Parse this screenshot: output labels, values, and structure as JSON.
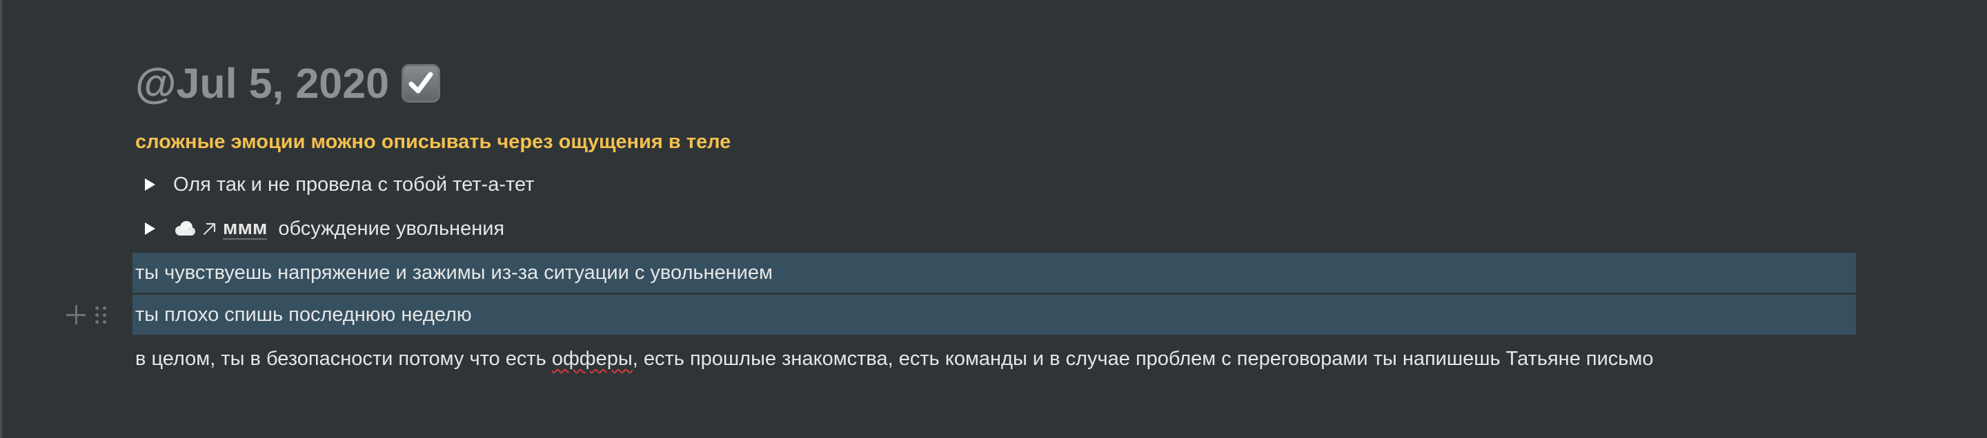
{
  "page": {
    "title": "@Jul 5, 2020",
    "title_icon": "check-mark-button-icon"
  },
  "blocks": {
    "highlight": "сложные эмоции можно описывать через ощущения в теле",
    "toggle_1": "Оля так и не провела с тобой тет-а-тет",
    "toggle_2": {
      "icon": "cloud-icon",
      "link_icon": "arrow-north-east-icon",
      "mention": "ммм",
      "text": "обсуждение увольнения"
    },
    "selected_1": "ты чувствуешь напряжение и зажимы из-за ситуации с увольнением",
    "selected_2": "ты плохо спишь последнюю неделю",
    "para": {
      "before": "в целом, ты в безопасности потому что есть ",
      "misspelled": "офферы",
      "after": ", есть прошлые знакомства, есть команды и в случае проблем с переговорами ты напишешь Татьяне письмо"
    }
  },
  "colors": {
    "background": "#2f3437",
    "highlight_yellow": "#f4c04d",
    "selection": "#365060",
    "title_gray": "#8d9094"
  }
}
